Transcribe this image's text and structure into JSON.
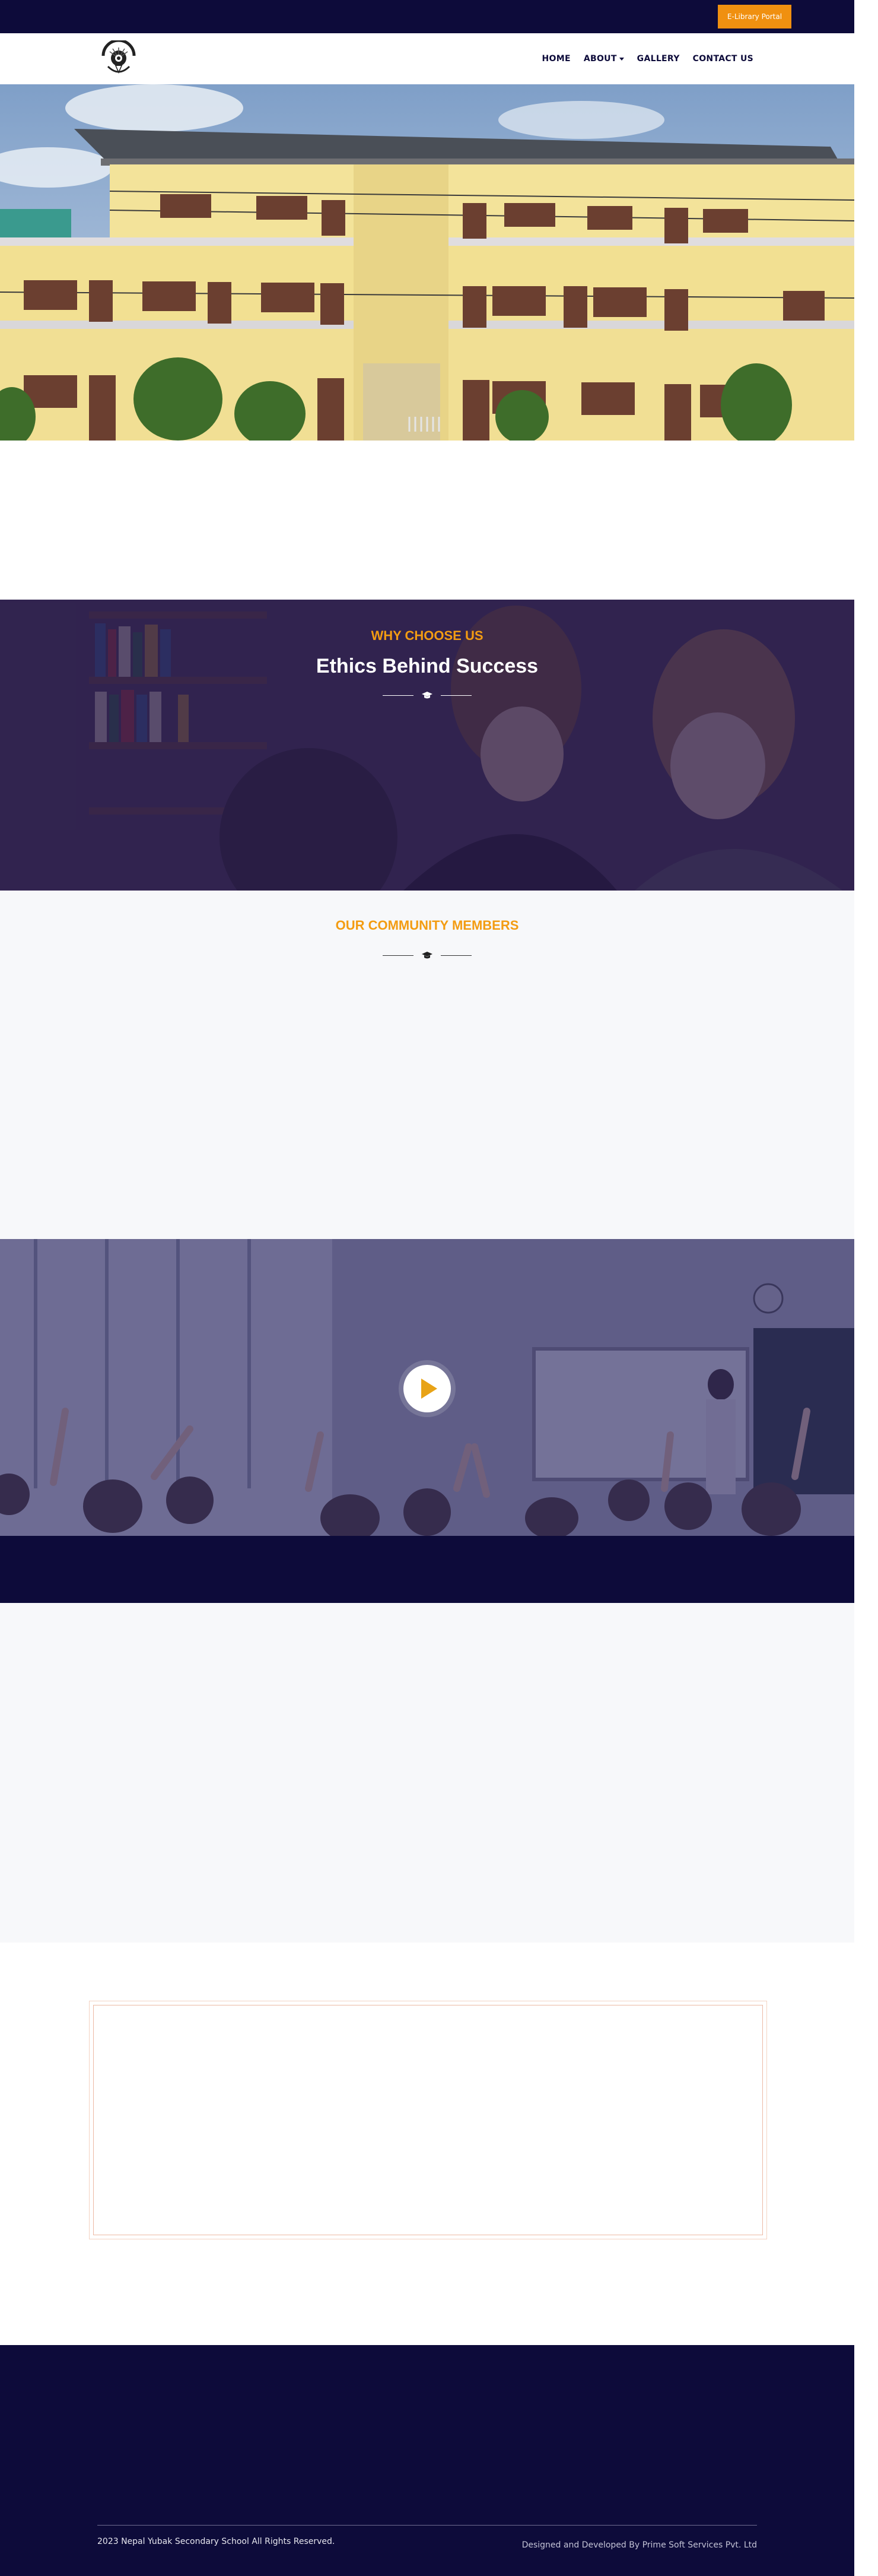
{
  "topbar": {
    "elibrary_label": "E-Library Portal"
  },
  "nav": {
    "items": [
      {
        "label": "HOME",
        "dropdown": false
      },
      {
        "label": "ABOUT",
        "dropdown": true
      },
      {
        "label": "GALLERY",
        "dropdown": false
      },
      {
        "label": "CONTACT US",
        "dropdown": false
      }
    ]
  },
  "why_choose": {
    "kicker": "WHY CHOOSE US",
    "heading": "Ethics Behind Success",
    "divider_icon": "graduation-cap-icon"
  },
  "community": {
    "kicker": "OUR COMMUNITY MEMBERS",
    "divider_icon": "graduation-cap-icon"
  },
  "video": {
    "icon": "play-icon"
  },
  "footer": {
    "copyright": "2023 Nepal Yubak Secondary School All Rights Reserved.",
    "credits": "Designed and Developed By Prime Soft Services Pvt. Ltd"
  },
  "colors": {
    "navy": "#0d0b3a",
    "accent_orange": "#f09010",
    "why_overlay": "#28194b",
    "light_section": "#f7f8fa"
  }
}
